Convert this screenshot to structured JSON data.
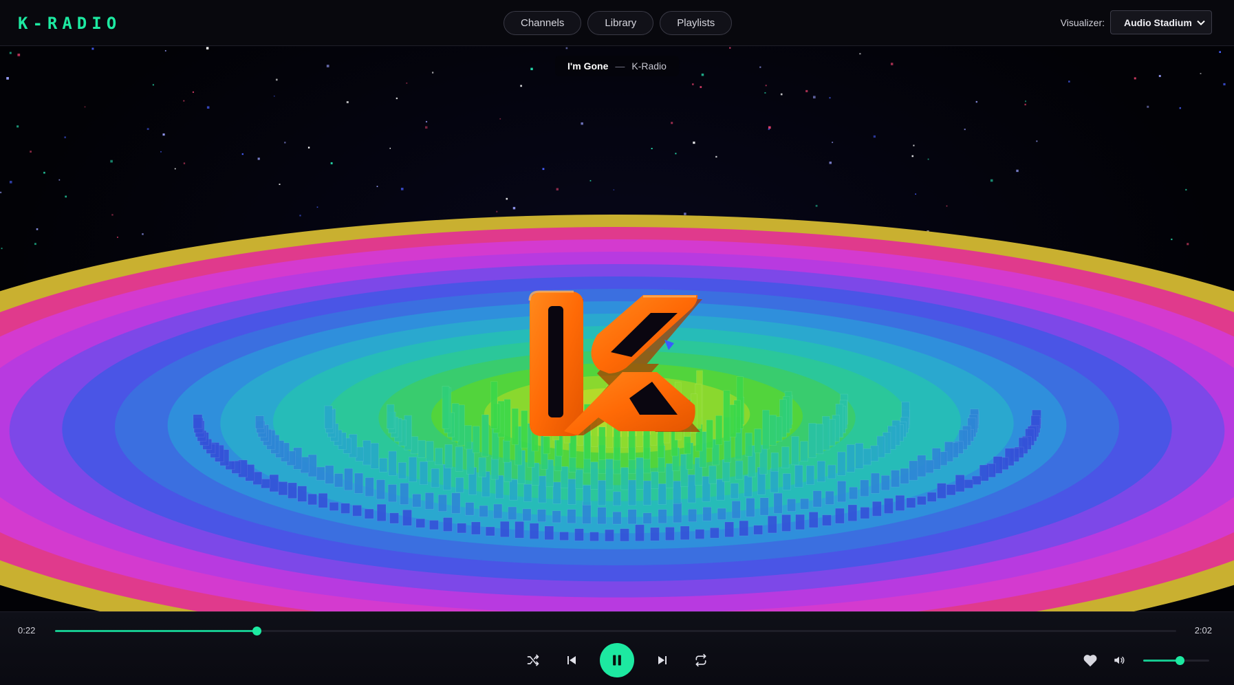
{
  "app": {
    "logo": "K-RADIO"
  },
  "nav": {
    "items": [
      {
        "label": "Channels"
      },
      {
        "label": "Library"
      },
      {
        "label": "Playlists"
      }
    ]
  },
  "visualizer": {
    "label": "Visualizer:",
    "selected": "Audio Stadium"
  },
  "now_playing": {
    "title": "I'm Gone",
    "separator": "—",
    "artist": "K-Radio"
  },
  "player": {
    "current_time": "0:22",
    "duration": "2:02",
    "progress_fraction": 0.18,
    "volume_fraction": 0.55
  },
  "colors": {
    "accent": "#1de9a1",
    "logo_orange": "#ff6d0a",
    "background": "#05050a"
  },
  "icons": {
    "shuffle": "shuffle-icon",
    "previous": "skip-previous-icon",
    "play_pause": "pause-icon",
    "next": "skip-next-icon",
    "repeat": "repeat-icon",
    "like": "heart-icon",
    "volume": "volume-icon"
  }
}
